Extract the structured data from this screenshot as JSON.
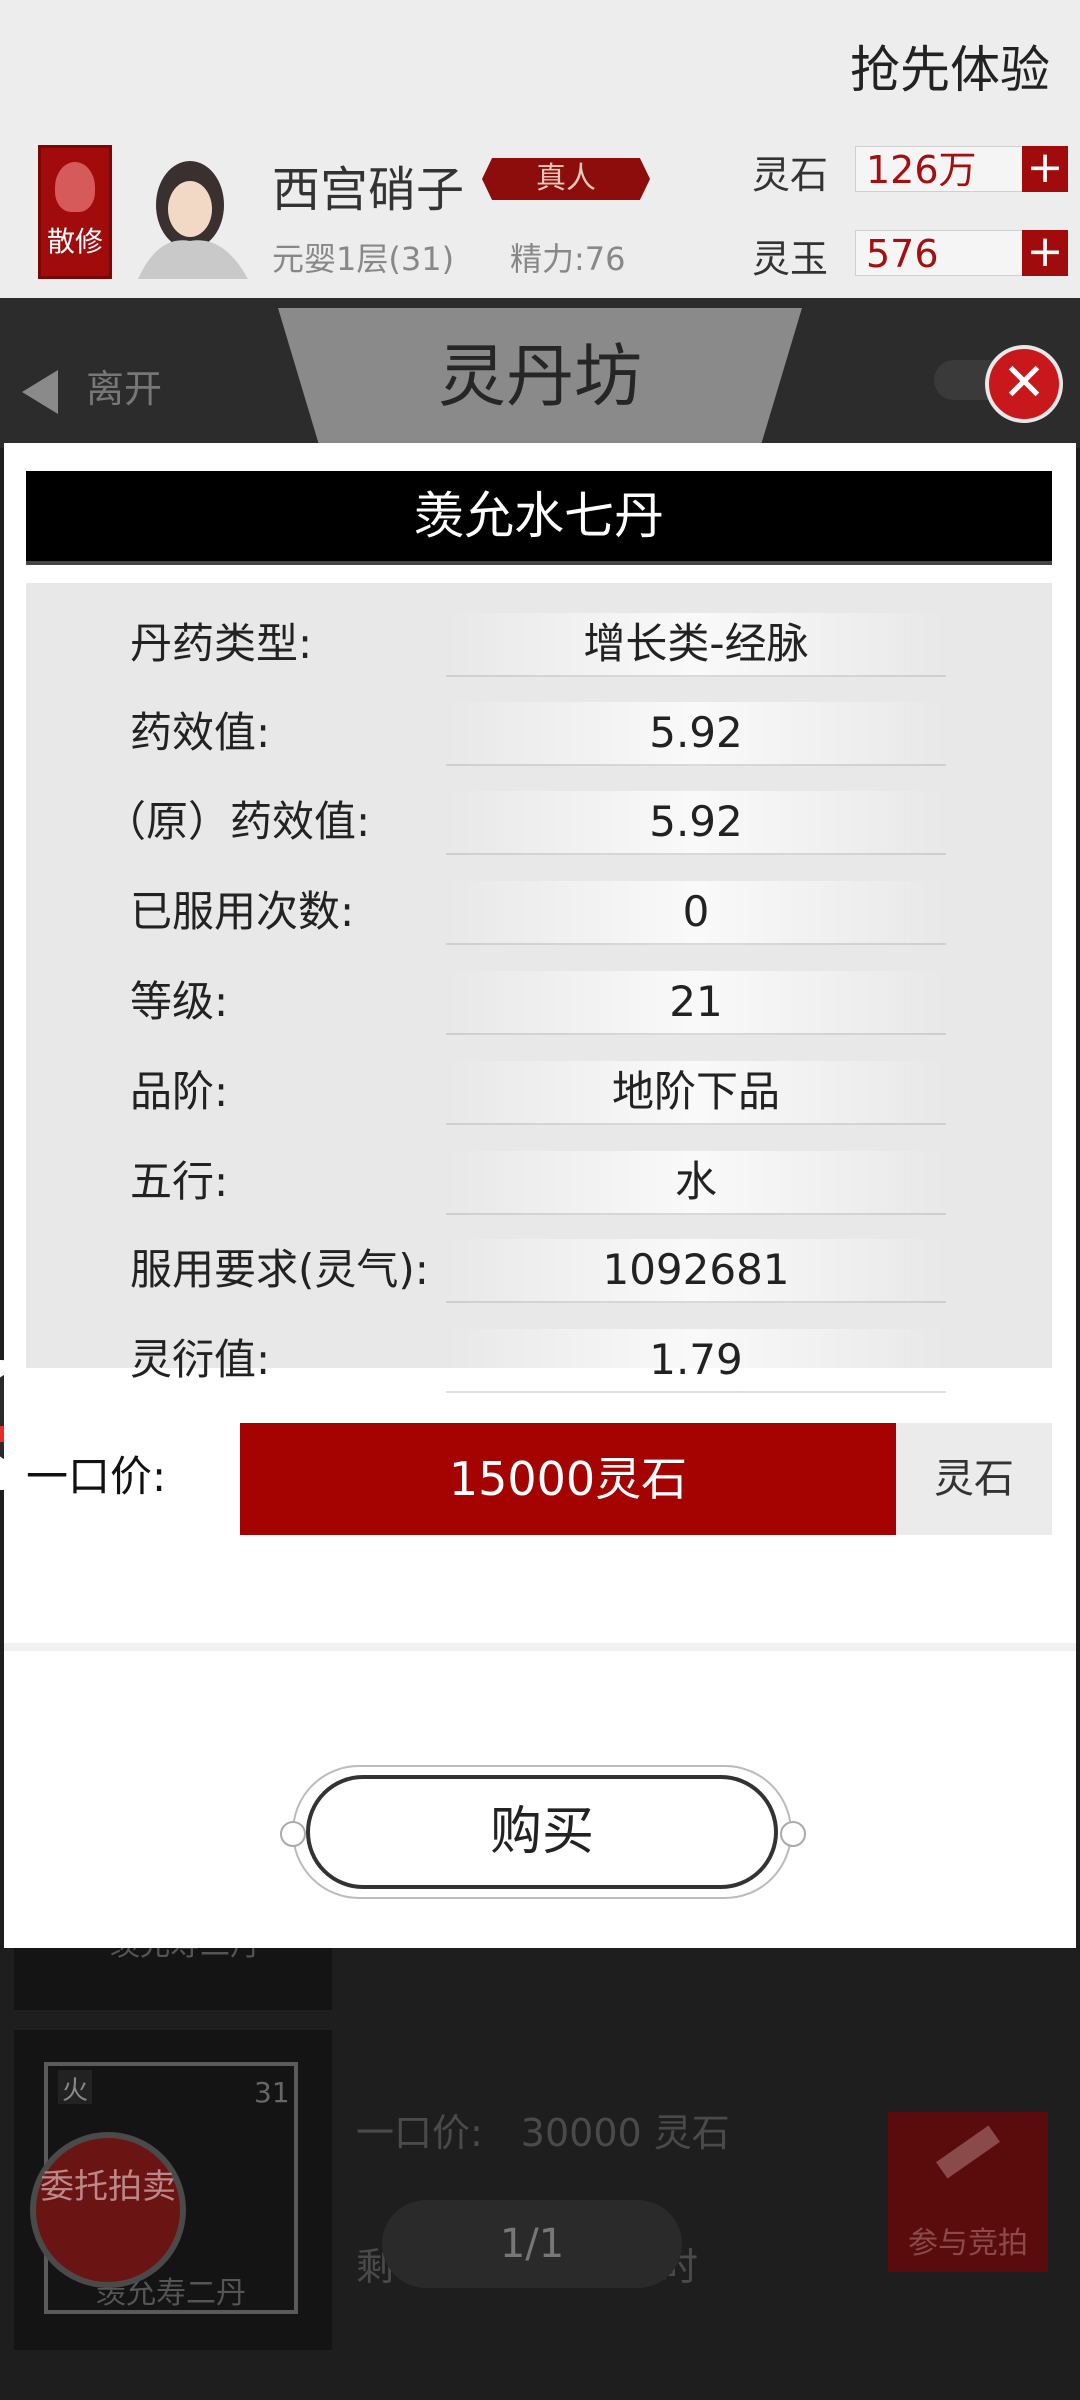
{
  "header": {
    "promo_label": "抢先体验",
    "sect_badge": "散修",
    "username": "西宫硝子",
    "real_tag": "真人",
    "rank": "元婴1层(31)",
    "energy": "精力:76",
    "lingshi_label": "灵石",
    "lingshi_value": "126万",
    "lingyu_label": "灵玉",
    "lingyu_value": "576",
    "plus": "+"
  },
  "nav": {
    "leave_label": "离开",
    "title": "灵丹坊",
    "close": "✕"
  },
  "modal": {
    "title": "羡允水七丹",
    "stats": [
      {
        "label": "丹药类型:",
        "value": "增长类-经脉"
      },
      {
        "label": "药效值:",
        "value": "5.92"
      },
      {
        "label": "（原）药效值:",
        "value": "5.92"
      },
      {
        "label": "已服用次数:",
        "value": "0"
      },
      {
        "label": "等级:",
        "value": "21"
      },
      {
        "label": "品阶:",
        "value": "地阶下品"
      },
      {
        "label": "五行:",
        "value": "水"
      },
      {
        "label": "服用要求(灵气):",
        "value": "1092681"
      },
      {
        "label": "灵衍值:",
        "value": "1.79"
      }
    ],
    "price_label": "一口价:",
    "price_value": "15000灵石",
    "currency_button": "灵石",
    "buy_label": "购买"
  },
  "background_list": {
    "item1_name": "羡允寿二丹",
    "item2_element": "火",
    "item2_level": "31",
    "item2_name": "羡允寿二丹",
    "item2_price": "一口价:　30000 灵石",
    "item2_remaining": "剩　　　　　　　时",
    "bid_label": "参与竞拍",
    "consign_label": "委托拍卖",
    "pager": "1/1"
  }
}
